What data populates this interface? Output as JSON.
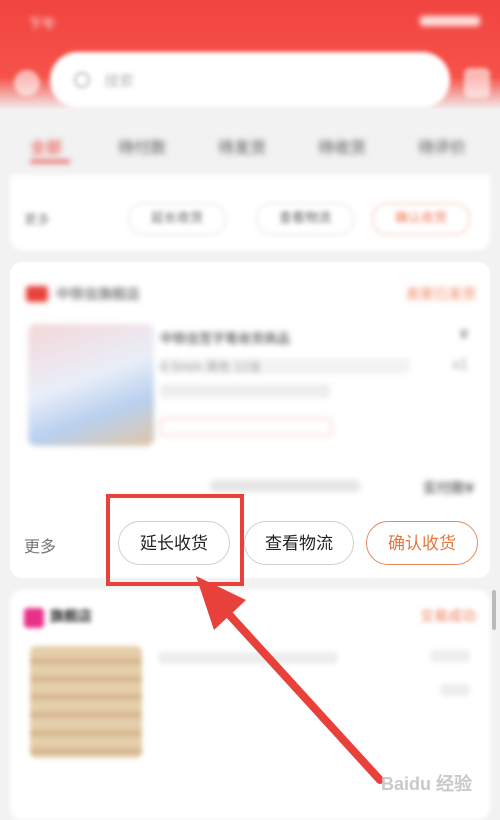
{
  "status_bar": {
    "time": "下午"
  },
  "search": {
    "placeholder": "搜索"
  },
  "tabs": [
    {
      "label": "全部",
      "active": true
    },
    {
      "label": "待付款"
    },
    {
      "label": "待发货"
    },
    {
      "label": "待收货"
    },
    {
      "label": "待评价"
    }
  ],
  "top_card": {
    "more_label": "更多",
    "buttons": [
      "延长收货",
      "查看物流",
      "确认收货"
    ]
  },
  "order": {
    "shop_name": "中铁信旗舰店",
    "status": "卖家已发货",
    "item_title": "中铁信签字笔收货商品",
    "item_price": "¥",
    "item_sku": "0.5mm 黑色 12支",
    "item_qty": "x1",
    "total": "实付款¥"
  },
  "actions": {
    "more": "更多",
    "extend": "延长收货",
    "logistics": "查看物流",
    "confirm": "确认收货"
  },
  "second_order": {
    "shop_name": "旗舰店",
    "status": "交易成功"
  },
  "watermark": "Baidu 经验",
  "colors": {
    "brand_red": "#e8403a",
    "confirm_orange": "#e4773f",
    "annotation_red": "#e8403a"
  }
}
